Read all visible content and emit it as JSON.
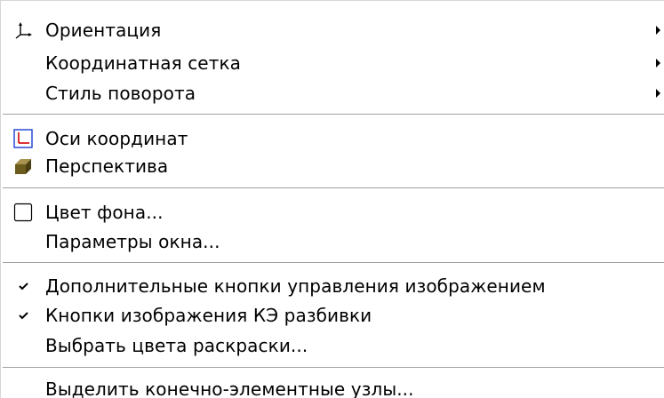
{
  "menu": {
    "items": [
      {
        "label": "Ориентация",
        "icon": "orientation-axes-icon",
        "submenu": true
      },
      {
        "label": "Координатная сетка",
        "submenu": true
      },
      {
        "label": "Стиль поворота",
        "submenu": true
      },
      {
        "label": "Оси координат",
        "icon": "coordinate-axes-icon"
      },
      {
        "label": "Перспектива",
        "icon": "perspective-cube-icon"
      },
      {
        "label": "Цвет фона...",
        "icon": "color-swatch-icon"
      },
      {
        "label": "Параметры окна..."
      },
      {
        "label": "Дополнительные кнопки управления изображением",
        "icon": "checkmark-icon",
        "checked": true
      },
      {
        "label": "Кнопки изображения КЭ разбивки",
        "icon": "checkmark-icon",
        "checked": true
      },
      {
        "label": "Выбрать цвета раскраски..."
      },
      {
        "label": "Выделить конечно-элементные узлы..."
      }
    ]
  },
  "colors": {
    "axis_red": "#d40000",
    "axis_blue": "#1a3fd0",
    "perspective_olive": "#7a6a2a",
    "separator": "#a0a0a0"
  }
}
